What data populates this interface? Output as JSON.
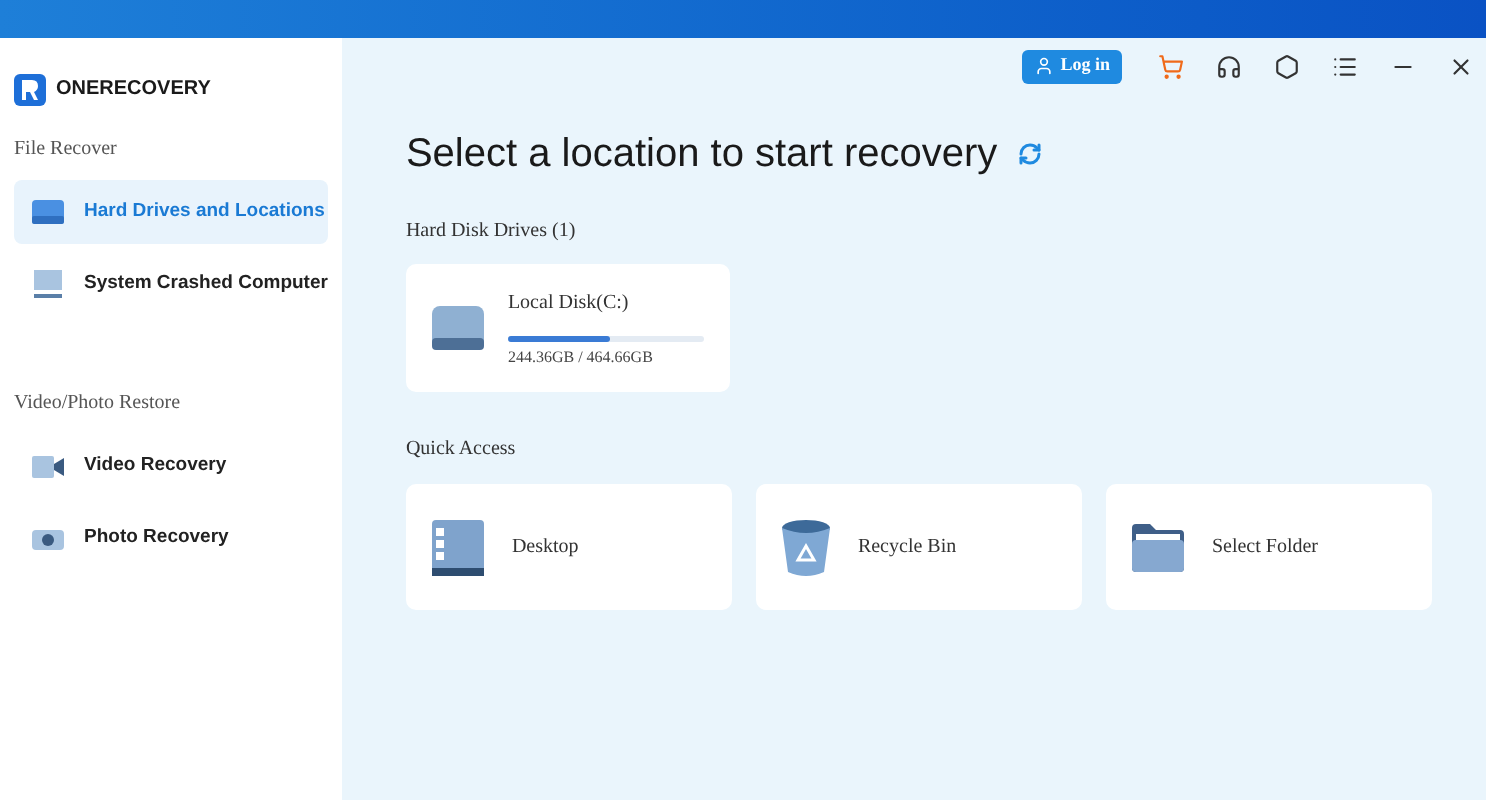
{
  "app": {
    "name": "ONERECOVERY"
  },
  "toolbar": {
    "login": "Log in"
  },
  "sidebar": {
    "sections": [
      {
        "title": "File Recover",
        "items": [
          {
            "label": "Hard Drives and Locations",
            "kind": "drive",
            "selected": true
          },
          {
            "label": "System Crashed Computer",
            "kind": "monitor",
            "selected": false
          }
        ]
      },
      {
        "title": "Video/Photo Restore",
        "items": [
          {
            "label": "Video Recovery",
            "kind": "video",
            "selected": false
          },
          {
            "label": "Photo Recovery",
            "kind": "camera",
            "selected": false
          }
        ]
      }
    ]
  },
  "main": {
    "title": "Select a location to start recovery",
    "drives_heading": "Hard Disk Drives (1)",
    "drives": [
      {
        "name": "Local Disk(C:)",
        "level": 0.525,
        "usage": "244.36GB / 464.66GB"
      }
    ],
    "quick_heading": "Quick Access",
    "quick": [
      {
        "label": "Desktop",
        "kind": "desktop"
      },
      {
        "label": "Recycle Bin",
        "kind": "bin"
      },
      {
        "label": "Select Folder",
        "kind": "folder"
      }
    ]
  }
}
